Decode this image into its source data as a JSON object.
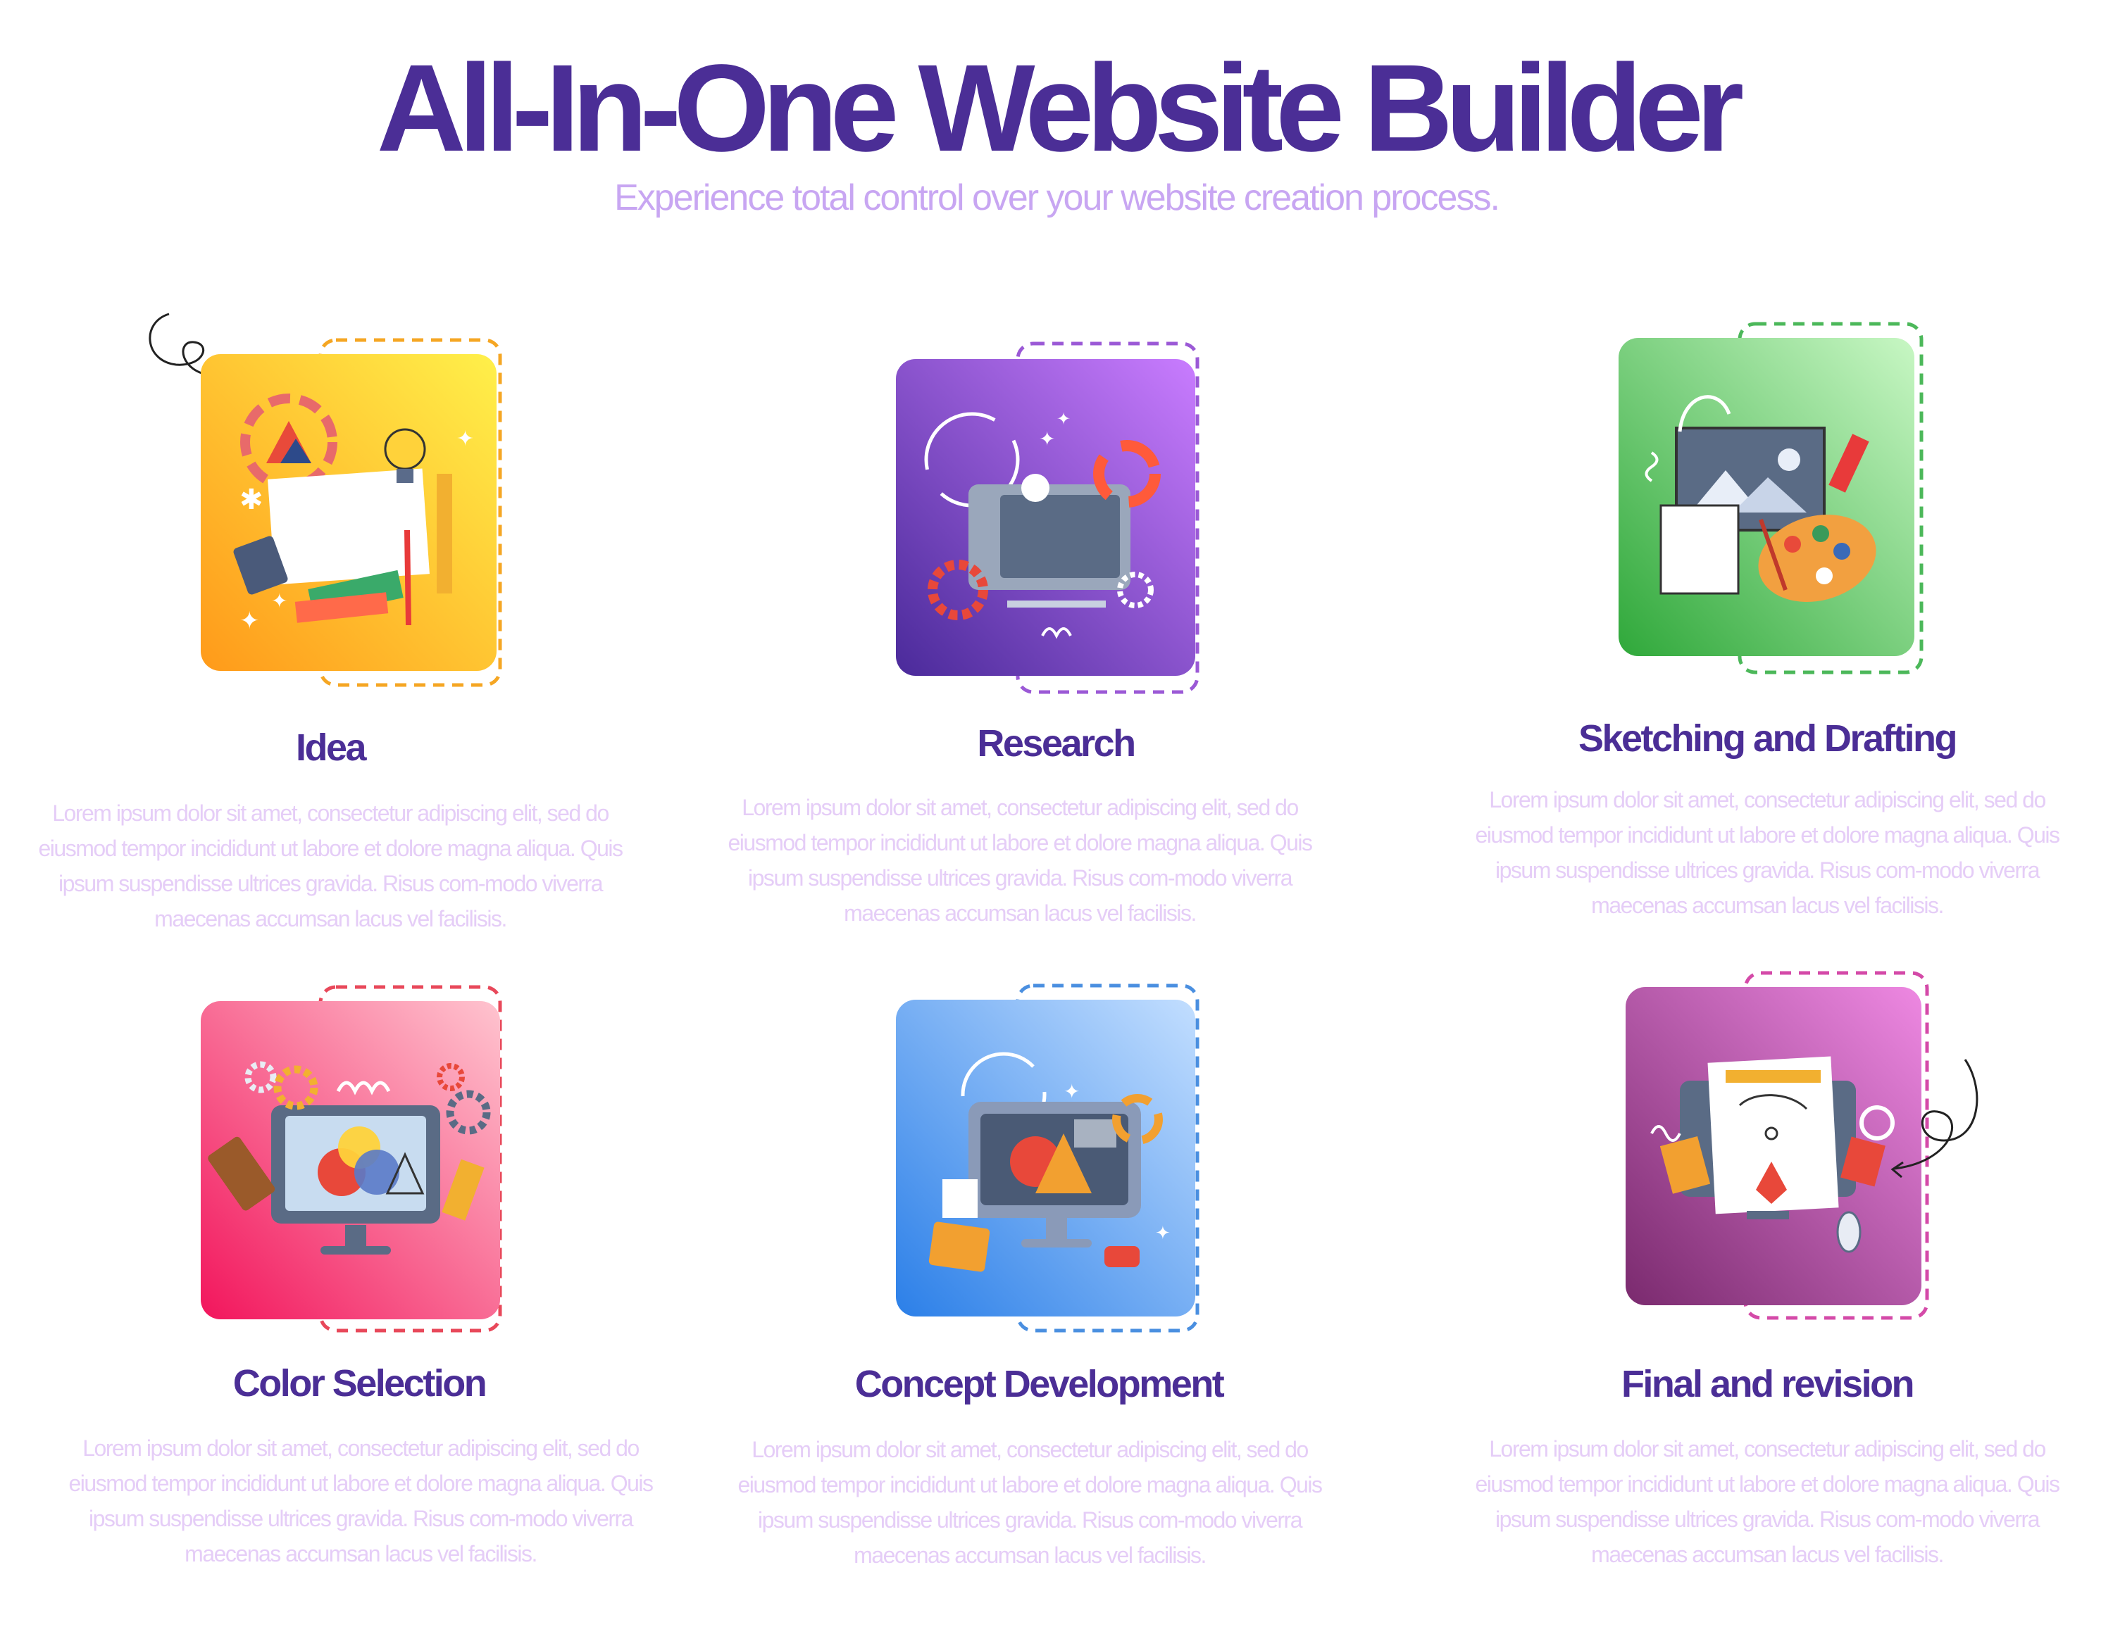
{
  "header": {
    "title": "All-In-One Website Builder",
    "subtitle": "Experience total control over your website creation process."
  },
  "features": [
    {
      "title": "Idea",
      "description": "Lorem ipsum dolor sit amet, consectetur adipiscing elit, sed do eiusmod tempor incididunt ut labore et dolore magna aliqua. Quis ipsum suspendisse ultrices gravida. Risus com-modo viverra maecenas accumsan lacus vel facilisis.",
      "icon": "idea-icon",
      "gradient_start": "#fff04a",
      "gradient_end": "#ff9a1a",
      "dash_color": "#f5a623"
    },
    {
      "title": "Research",
      "description": "Lorem ipsum dolor sit amet, consectetur adipiscing elit, sed do eiusmod tempor incididunt ut labore et dolore magna aliqua. Quis ipsum suspendisse ultrices gravida. Risus com-modo viverra maecenas accumsan lacus vel facilisis.",
      "icon": "research-icon",
      "gradient_start": "#c97cff",
      "gradient_end": "#4a2a9a",
      "dash_color": "#9b59d6"
    },
    {
      "title": "Sketching and Drafting",
      "description": "Lorem ipsum dolor sit amet, consectetur adipiscing elit, sed do eiusmod tempor incididunt ut labore et dolore magna aliqua. Quis ipsum suspendisse ultrices gravida. Risus com-modo viverra maecenas accumsan lacus vel facilisis.",
      "icon": "sketching-icon",
      "gradient_start": "#c8f7c4",
      "gradient_end": "#2fa83a",
      "dash_color": "#4cb85a"
    },
    {
      "title": "Color Selection",
      "description": "Lorem ipsum dolor sit amet, consectetur adipiscing elit, sed do eiusmod tempor incididunt ut labore et dolore magna aliqua. Quis ipsum suspendisse ultrices gravida. Risus com-modo viverra maecenas accumsan lacus vel facilisis.",
      "icon": "color-selection-icon",
      "gradient_start": "#ffc4cf",
      "gradient_end": "#f2155c",
      "dash_color": "#e8485a"
    },
    {
      "title": "Concept Development",
      "description": "Lorem ipsum dolor sit amet, consectetur adipiscing elit, sed do eiusmod tempor incididunt ut labore et dolore magna aliqua. Quis ipsum suspendisse ultrices gravida. Risus com-modo viverra maecenas accumsan lacus vel facilisis.",
      "icon": "concept-development-icon",
      "gradient_start": "#c2deff",
      "gradient_end": "#2b7fe8",
      "dash_color": "#4a8fe0"
    },
    {
      "title": "Final and revision",
      "description": "Lorem ipsum dolor sit amet, consectetur adipiscing elit, sed do eiusmod tempor incididunt ut labore et dolore magna aliqua. Quis ipsum suspendisse ultrices gravida. Risus com-modo viverra maecenas accumsan lacus vel facilisis.",
      "icon": "final-revision-icon",
      "gradient_start": "#ee88e2",
      "gradient_end": "#7a2a6e",
      "dash_color": "#d44aa8"
    }
  ]
}
